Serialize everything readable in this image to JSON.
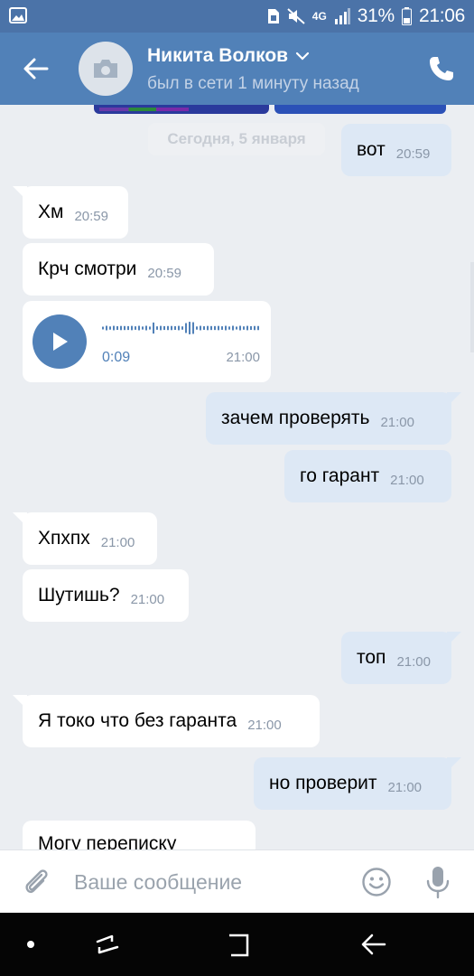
{
  "status_bar": {
    "network": "4G",
    "battery": "31%",
    "time": "21:06"
  },
  "header": {
    "name": "Никита Волков",
    "status": "был в сети 1 минуту назад"
  },
  "chat": {
    "date_label": "Сегодня, 5 января",
    "messages": [
      {
        "dir": "out",
        "text": "вот",
        "time": "20:59"
      },
      {
        "dir": "in",
        "text": "Хм",
        "time": "20:59"
      },
      {
        "dir": "in",
        "text": "Крч смотри",
        "time": "20:59"
      },
      {
        "dir": "in",
        "type": "voice",
        "duration": "0:09",
        "time": "21:00"
      },
      {
        "dir": "out",
        "text": "зачем проверять",
        "time": "21:00"
      },
      {
        "dir": "out",
        "text": "го гарант",
        "time": "21:00"
      },
      {
        "dir": "in",
        "text": "Хпхпх",
        "time": "21:00"
      },
      {
        "dir": "in",
        "text": "Шутишь?",
        "time": "21:00"
      },
      {
        "dir": "out",
        "text": "топ",
        "time": "21:00"
      },
      {
        "dir": "in",
        "text": "Я токо что без гаранта",
        "time": "21:00"
      },
      {
        "dir": "out",
        "text": "но проверит",
        "time": "21:00"
      },
      {
        "dir": "in",
        "text": "Могу переписку",
        "time": ""
      }
    ]
  },
  "composer": {
    "placeholder": "Ваше сообщение"
  },
  "colors": {
    "header": "#5181b8",
    "status_bar": "#4b73a8",
    "chat_background": "#ebeef2",
    "incoming_bubble": "#ffffff",
    "outgoing_bubble": "#dde8f5",
    "accent": "#5181b8"
  },
  "icons": [
    "gallery-notification-icon",
    "sim-icon",
    "mute-icon",
    "signal-icon",
    "battery-icon",
    "back-arrow-icon",
    "camera-icon",
    "chevron-down-icon",
    "phone-icon",
    "play-icon",
    "paperclip-icon",
    "emoji-icon",
    "microphone-icon"
  ]
}
